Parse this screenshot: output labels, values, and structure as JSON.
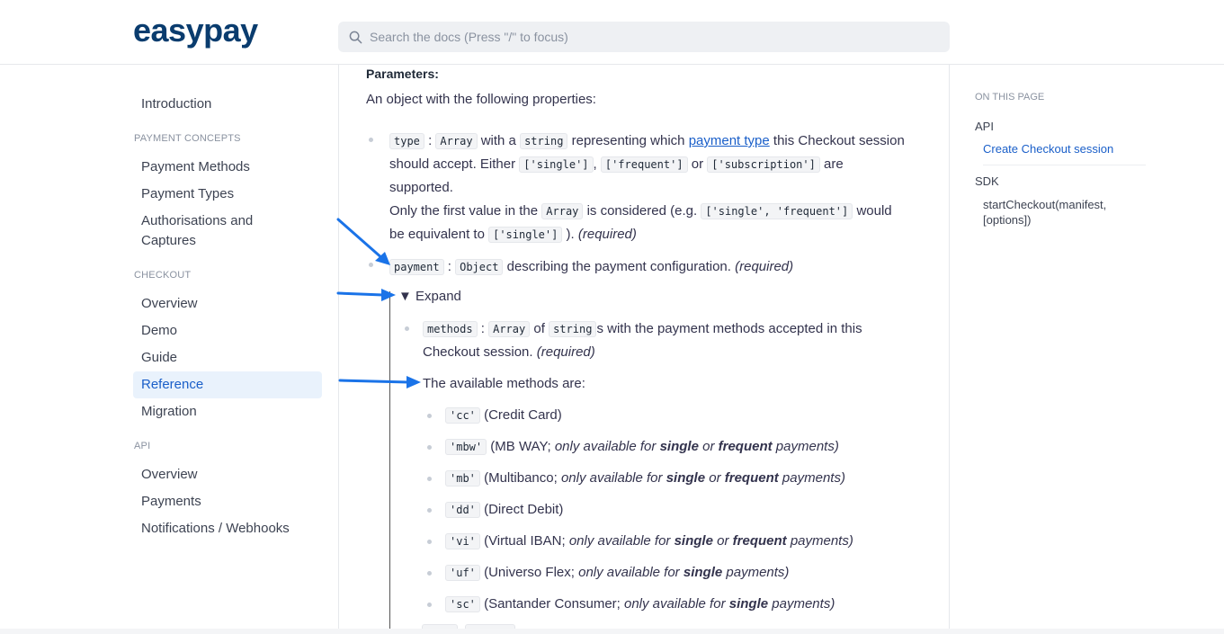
{
  "brand": {
    "logo_part1": "easy",
    "logo_part2": "pay"
  },
  "search": {
    "placeholder": "Search the docs (Press \"/\" to focus)"
  },
  "sidebar": {
    "intro": "Introduction",
    "group_concepts": "PAYMENT CONCEPTS",
    "concepts": [
      "Payment Methods",
      "Payment Types",
      "Authorisations and Captures"
    ],
    "group_checkout": "CHECKOUT",
    "checkout": [
      "Overview",
      "Demo",
      "Guide",
      "Reference",
      "Migration"
    ],
    "group_api": "API",
    "api": [
      "Overview",
      "Payments",
      "Notifications / Webhooks"
    ]
  },
  "content": {
    "params_title": "Parameters:",
    "intro": "An object with the following properties:",
    "type": {
      "key": "type",
      "colon": ":",
      "array": "Array",
      "with_a": "with a",
      "string": "string",
      "representing": "representing which",
      "link": "payment type",
      "rest1": "this Checkout session",
      "should": "should accept. Either",
      "opt_single": "['single']",
      "comma": ",",
      "opt_frequent": "['frequent']",
      "or": "or",
      "opt_sub": "['subscription']",
      "are": "are",
      "supported": "supported.",
      "only_first": "Only the first value in the",
      "array2": "Array",
      "considered": "is considered (e.g.",
      "example": "['single', 'frequent']",
      "would": "would",
      "be_equiv": "be equivalent to",
      "equiv_val": "['single']",
      "close": ").",
      "required": "(required)"
    },
    "payment": {
      "key": "payment",
      "colon": ":",
      "object": "Object",
      "desc": "describing the payment configuration.",
      "required": "(required)"
    },
    "expand_label": "▼ Expand",
    "methods": {
      "key": "methods",
      "colon": ":",
      "array": "Array",
      "of": "of",
      "string": "string",
      "rest": "s with the payment methods accepted in this",
      "line2": "Checkout session.",
      "required": "(required)"
    },
    "available": "The available methods are:",
    "method_list": [
      {
        "code": "'cc'",
        "name": "(Credit Card)"
      },
      {
        "code": "'mbw'",
        "name": "(MB WAY;",
        "note": "only available for",
        "b1": "single",
        "or": "or",
        "b2": "frequent",
        "end": "payments)"
      },
      {
        "code": "'mb'",
        "name": "(Multibanco;",
        "note": "only available for",
        "b1": "single",
        "or": "or",
        "b2": "frequent",
        "end": "payments)"
      },
      {
        "code": "'dd'",
        "name": "(Direct Debit)"
      },
      {
        "code": "'vi'",
        "name": "(Virtual IBAN;",
        "note": "only available for",
        "b1": "single",
        "or": "or",
        "b2": "frequent",
        "end": "payments)"
      },
      {
        "code": "'uf'",
        "name": "(Universo Flex;",
        "note": "only available for",
        "b1": "single",
        "end": "payments)"
      },
      {
        "code": "'sc'",
        "name": "(Santander Consumer;",
        "note": "only available for",
        "b1": "single",
        "end": "payments)"
      }
    ]
  },
  "toc": {
    "heading": "ON THIS PAGE",
    "api": "API",
    "api_sub": "Create Checkout session",
    "sdk": "SDK",
    "sdk_sub": "startCheckout(manifest, [options])"
  },
  "colors": {
    "accent": "#1a5fc9",
    "arrow": "#1a73e8",
    "logo": "#0a3c6e"
  }
}
